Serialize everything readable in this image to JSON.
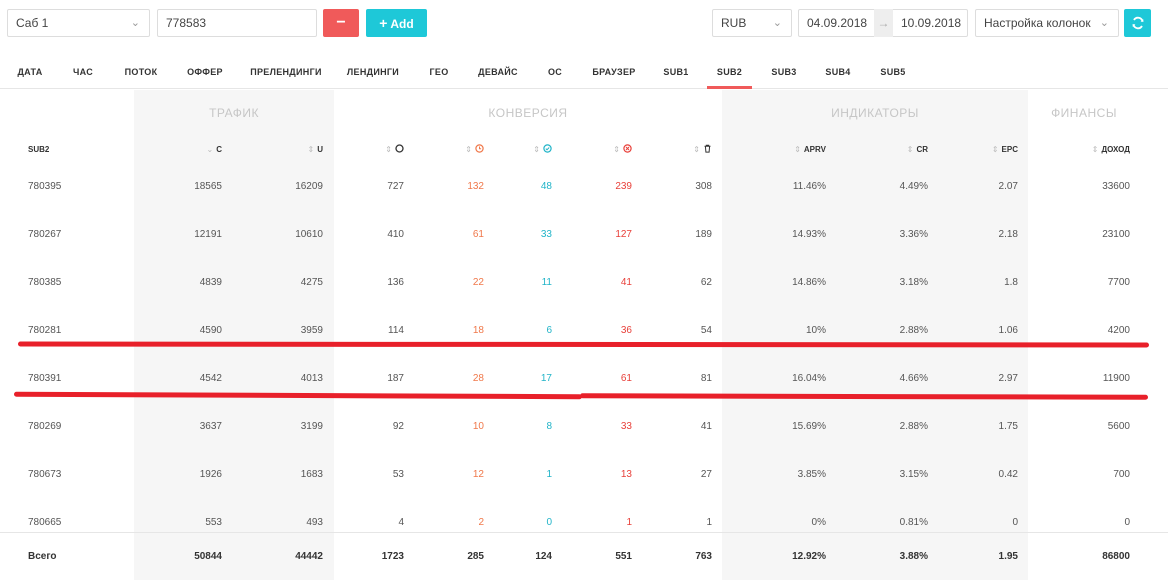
{
  "toolbar": {
    "group_select": "Саб 1",
    "search_value": "778583",
    "minus_label": "−",
    "add_label": "Add",
    "currency": "RUB",
    "date_from": "04.09.2018",
    "date_to": "10.09.2018",
    "date_arrow": "→",
    "columns_select": "Настройка колонок"
  },
  "tabs": [
    "ДАТА",
    "ЧАС",
    "ПОТОК",
    "ОФФЕР",
    "ПРЕЛЕНДИНГИ",
    "ЛЕНДИНГИ",
    "ГЕО",
    "ДЕВАЙС",
    "ОС",
    "БРАУЗЕР",
    "SUB1",
    "SUB2",
    "SUB3",
    "SUB4",
    "SUB5"
  ],
  "active_tab": "SUB2",
  "groups": {
    "traffic": "ТРАФИК",
    "conversion": "КОНВЕРСИЯ",
    "indicators": "ИНДИКАТОРЫ",
    "finance": "ФИНАНСЫ"
  },
  "headers": {
    "sub2": "SUB2",
    "c": "C",
    "u": "U",
    "aprv": "APRV",
    "cr": "CR",
    "epc": "EPC",
    "income": "ДОХОД"
  },
  "rows": [
    {
      "sub2": "780395",
      "c": "18565",
      "u": "16209",
      "total": "727",
      "pending": "132",
      "approved": "48",
      "rejected": "239",
      "trash": "308",
      "aprv": "11.46%",
      "cr": "4.49%",
      "epc": "2.07",
      "income": "33600"
    },
    {
      "sub2": "780267",
      "c": "12191",
      "u": "10610",
      "total": "410",
      "pending": "61",
      "approved": "33",
      "rejected": "127",
      "trash": "189",
      "aprv": "14.93%",
      "cr": "3.36%",
      "epc": "2.18",
      "income": "23100"
    },
    {
      "sub2": "780385",
      "c": "4839",
      "u": "4275",
      "total": "136",
      "pending": "22",
      "approved": "11",
      "rejected": "41",
      "trash": "62",
      "aprv": "14.86%",
      "cr": "3.18%",
      "epc": "1.8",
      "income": "7700"
    },
    {
      "sub2": "780281",
      "c": "4590",
      "u": "3959",
      "total": "114",
      "pending": "18",
      "approved": "6",
      "rejected": "36",
      "trash": "54",
      "aprv": "10%",
      "cr": "2.88%",
      "epc": "1.06",
      "income": "4200"
    },
    {
      "sub2": "780391",
      "c": "4542",
      "u": "4013",
      "total": "187",
      "pending": "28",
      "approved": "17",
      "rejected": "61",
      "trash": "81",
      "aprv": "16.04%",
      "cr": "4.66%",
      "epc": "2.97",
      "income": "11900"
    },
    {
      "sub2": "780269",
      "c": "3637",
      "u": "3199",
      "total": "92",
      "pending": "10",
      "approved": "8",
      "rejected": "33",
      "trash": "41",
      "aprv": "15.69%",
      "cr": "2.88%",
      "epc": "1.75",
      "income": "5600"
    },
    {
      "sub2": "780673",
      "c": "1926",
      "u": "1683",
      "total": "53",
      "pending": "12",
      "approved": "1",
      "rejected": "13",
      "trash": "27",
      "aprv": "3.85%",
      "cr": "3.15%",
      "epc": "0.42",
      "income": "700"
    },
    {
      "sub2": "780665",
      "c": "553",
      "u": "493",
      "total": "4",
      "pending": "2",
      "approved": "0",
      "rejected": "1",
      "trash": "1",
      "aprv": "0%",
      "cr": "0.81%",
      "epc": "0",
      "income": "0"
    }
  ],
  "totals": {
    "sub2": "Всего",
    "c": "50844",
    "u": "44442",
    "total": "1723",
    "pending": "285",
    "approved": "124",
    "rejected": "551",
    "trash": "763",
    "aprv": "12.92%",
    "cr": "3.88%",
    "epc": "1.95",
    "income": "86800"
  },
  "colors": {
    "accent_red": "#f05a5a",
    "accent_teal": "#1ec8d8",
    "pending": "#f0784a",
    "approved": "#21b4c8",
    "rejected": "#e8403a",
    "annotation": "#e8202a"
  }
}
